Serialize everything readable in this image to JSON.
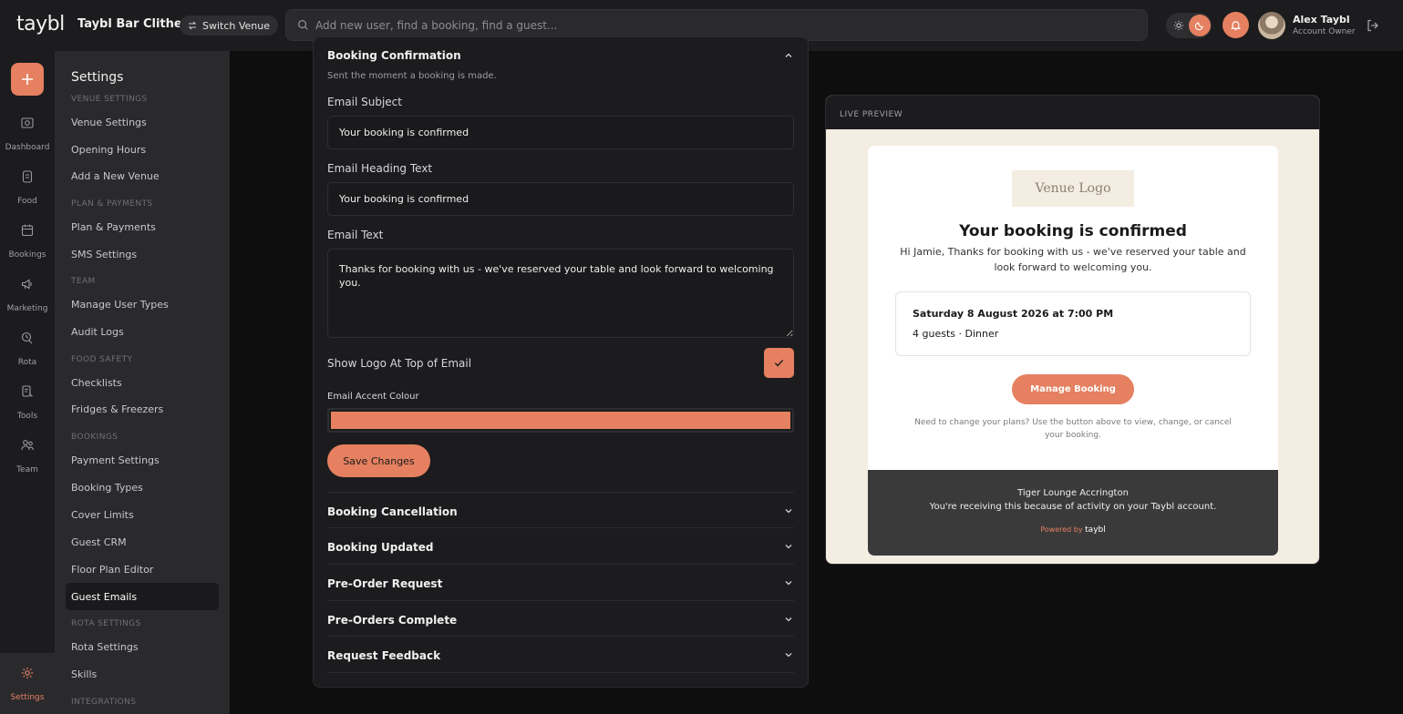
{
  "topbar": {
    "logo": "taybl",
    "venue_name": "Taybl Bar Clitheroe",
    "switch_venue_label": "Switch Venue",
    "search_placeholder": "Add new user, find a booking, find a guest...",
    "user_name": "Alex Taybl",
    "user_role": "Account Owner"
  },
  "rail": {
    "items": [
      "Dashboard",
      "Food",
      "Bookings",
      "Marketing",
      "Rota",
      "Tools",
      "Team"
    ],
    "settings_label": "Settings"
  },
  "sidebar": {
    "title": "Settings",
    "sections": [
      {
        "label": "VENUE SETTINGS",
        "items": [
          "Venue Settings",
          "Opening Hours",
          "Add a New Venue"
        ]
      },
      {
        "label": "PLAN & PAYMENTS",
        "items": [
          "Plan & Payments",
          "SMS Settings"
        ]
      },
      {
        "label": "TEAM",
        "items": [
          "Manage User Types",
          "Audit Logs"
        ]
      },
      {
        "label": "FOOD SAFETY",
        "items": [
          "Checklists",
          "Fridges & Freezers"
        ]
      },
      {
        "label": "BOOKINGS",
        "items": [
          "Payment Settings",
          "Booking Types",
          "Cover Limits",
          "Guest CRM",
          "Floor Plan Editor",
          "Guest Emails"
        ]
      },
      {
        "label": "ROTA SETTINGS",
        "items": [
          "Rota Settings",
          "Skills"
        ]
      },
      {
        "label": "INTEGRATIONS",
        "items": []
      }
    ]
  },
  "editor": {
    "section_title": "Booking Confirmation",
    "section_desc": "Sent the moment a booking is made.",
    "subject_label": "Email Subject",
    "subject_value": "Your booking is confirmed",
    "heading_label": "Email Heading Text",
    "heading_value": "Your booking is confirmed",
    "text_label": "Email Text",
    "text_value": "Thanks for booking with us - we've reserved your table and look forward to welcoming you.",
    "show_logo_label": "Show Logo At Top of Email",
    "accent_label": "Email Accent Colour",
    "accent_color": "#e58060",
    "save_label": "Save Changes",
    "collapsed_sections": [
      "Booking Cancellation",
      "Booking Updated",
      "Pre-Order Request",
      "Pre-Orders Complete",
      "Request Feedback"
    ]
  },
  "preview": {
    "header_label": "LIVE PREVIEW",
    "logo_placeholder": "Venue Logo",
    "heading": "Your booking is confirmed",
    "body": "Hi Jamie, Thanks for booking with us - we've reserved your table and look forward to welcoming you.",
    "booking_date": "Saturday 8 August 2026 at 7:00 PM",
    "booking_meta": "4 guests · Dinner",
    "manage_label": "Manage Booking",
    "help_text": "Need to change your plans? Use the button above to view, change, or cancel your booking.",
    "footer_venue": "Tiger Lounge Accrington",
    "footer_note": "You're receiving this because of activity on your Taybl account.",
    "powered_by": "Powered by",
    "powered_brand": "taybl"
  }
}
